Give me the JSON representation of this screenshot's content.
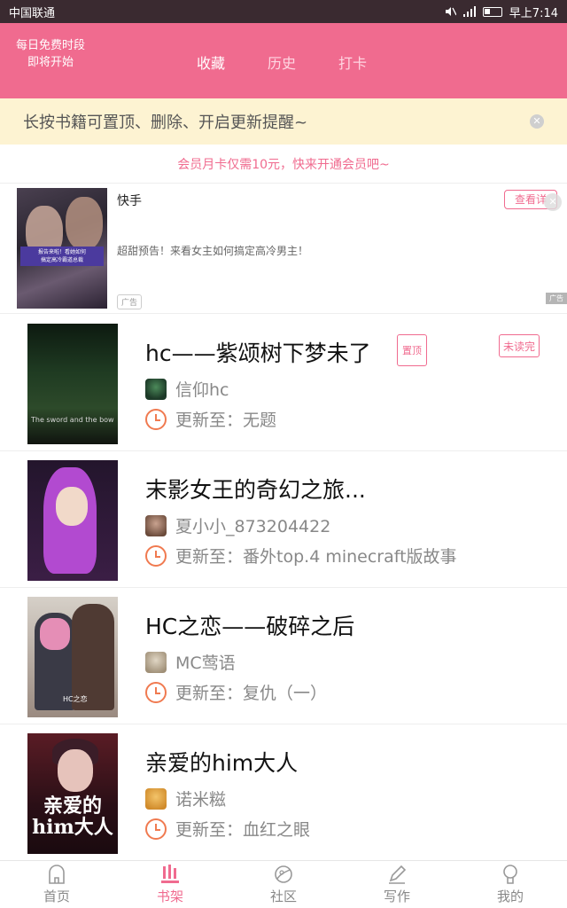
{
  "status_bar": {
    "carrier": "中国联通",
    "time": "早上7:14"
  },
  "header": {
    "free_line1": "每日免费时段",
    "free_line2": "即将开始",
    "tabs": [
      {
        "label": "收藏",
        "active": true
      },
      {
        "label": "历史",
        "active": false
      },
      {
        "label": "打卡",
        "active": false
      }
    ]
  },
  "tip": {
    "text": "长按书籍可置顶、删除、开启更新提醒~"
  },
  "vip_banner": {
    "text": "会员月卡仅需10元，快来开通会员吧~"
  },
  "ad": {
    "title": "快手",
    "description": "超甜预告！来看女主如何搞定高冷男主！",
    "cta": "查看详",
    "tag": "广告",
    "image_caption": "报告来啦！看她如何\n搞定高冷霸道总裁"
  },
  "books": [
    {
      "title": "hc——紫颂树下梦未了",
      "author": "信仰hc",
      "update_prefix": "更新至：",
      "update": "无题",
      "cover_text": "The sword and the bow",
      "pinned_label": "置顶",
      "status_label": "未读完"
    },
    {
      "title": "末影女王的奇幻之旅...",
      "author": "夏小小_873204422",
      "update_prefix": "更新至：",
      "update": "番外top.4 minecraft版故事"
    },
    {
      "title": "HC之恋——破碎之后",
      "author": "MC莺语",
      "update_prefix": "更新至：",
      "update": "复仇（一）",
      "cover_text": "HC之恋"
    },
    {
      "title": "亲爱的him大人",
      "author": "诺米糍",
      "update_prefix": "更新至：",
      "update": "血红之眼",
      "cover_text": "亲爱的\nhim大人"
    }
  ],
  "bottom_nav": [
    {
      "label": "首页",
      "icon": "home-icon",
      "active": false
    },
    {
      "label": "书架",
      "icon": "bookshelf-icon",
      "active": true
    },
    {
      "label": "社区",
      "icon": "community-icon",
      "active": false
    },
    {
      "label": "写作",
      "icon": "pencil-icon",
      "active": false
    },
    {
      "label": "我的",
      "icon": "profile-icon",
      "active": false
    }
  ],
  "colors": {
    "brand_pink": "#f06b8f",
    "tip_bg": "#fdf3d2",
    "clock_orange": "#f07a50"
  }
}
